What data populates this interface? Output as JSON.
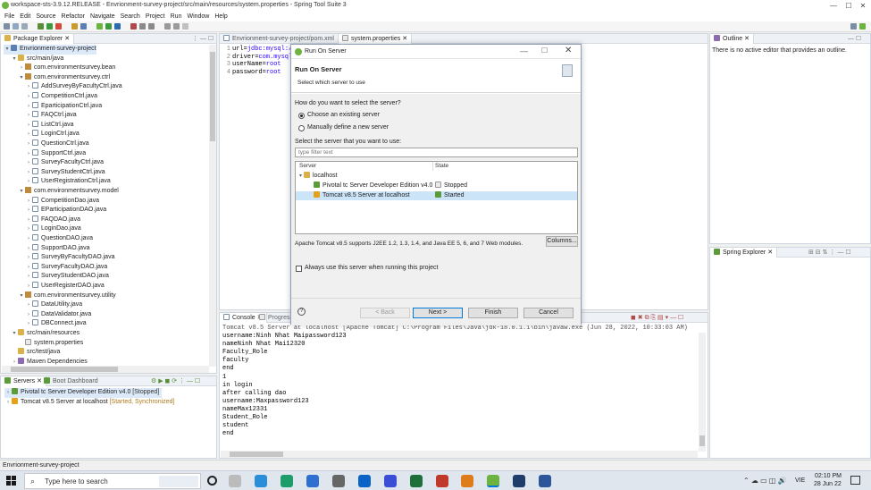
{
  "window": {
    "title": "workspace-sts-3.9.12.RELEASE - Envrionment-survey-project/src/main/resources/system.properties - Spring Tool Suite 3"
  },
  "menu": [
    "File",
    "Edit",
    "Source",
    "Refactor",
    "Navigate",
    "Search",
    "Project",
    "Run",
    "Window",
    "Help"
  ],
  "package_explorer": {
    "tab": "Package Explorer",
    "tree": [
      {
        "label": "Envrionment-survey-project",
        "level": 0,
        "icon": "proj",
        "exp": "▾"
      },
      {
        "label": "src/main/java",
        "level": 1,
        "icon": "folder",
        "exp": "▾"
      },
      {
        "label": "com.environmentsurvey.bean",
        "level": 2,
        "icon": "pkg",
        "exp": "›"
      },
      {
        "label": "com.environmentsurvey.ctrl",
        "level": 2,
        "icon": "pkg",
        "exp": "▾"
      },
      {
        "label": "AddSurveyByFacultyCtrl.java",
        "level": 3,
        "icon": "java",
        "exp": "›"
      },
      {
        "label": "CompetitionCtrl.java",
        "level": 3,
        "icon": "java",
        "exp": "›"
      },
      {
        "label": "EparticipationCtrl.java",
        "level": 3,
        "icon": "java",
        "exp": "›"
      },
      {
        "label": "FAQCtrl.java",
        "level": 3,
        "icon": "java",
        "exp": "›"
      },
      {
        "label": "ListCtrl.java",
        "level": 3,
        "icon": "java",
        "exp": "›"
      },
      {
        "label": "LoginCtrl.java",
        "level": 3,
        "icon": "java",
        "exp": "›"
      },
      {
        "label": "QuestionCtrl.java",
        "level": 3,
        "icon": "java",
        "exp": "›"
      },
      {
        "label": "SupportCtrl.java",
        "level": 3,
        "icon": "java",
        "exp": "›"
      },
      {
        "label": "SurveyFacultyCtrl.java",
        "level": 3,
        "icon": "java",
        "exp": "›"
      },
      {
        "label": "SurveyStudentCtrl.java",
        "level": 3,
        "icon": "java",
        "exp": "›"
      },
      {
        "label": "UserRegistrationCtrl.java",
        "level": 3,
        "icon": "java",
        "exp": "›"
      },
      {
        "label": "com.environmentsurvey.model",
        "level": 2,
        "icon": "pkg",
        "exp": "▾"
      },
      {
        "label": "CompetitionDao.java",
        "level": 3,
        "icon": "java",
        "exp": "›"
      },
      {
        "label": "EParticipationDAO.java",
        "level": 3,
        "icon": "java",
        "exp": "›"
      },
      {
        "label": "FAQDAO.java",
        "level": 3,
        "icon": "java",
        "exp": "›"
      },
      {
        "label": "LoginDao.java",
        "level": 3,
        "icon": "java",
        "exp": "›"
      },
      {
        "label": "QuestionDAO.java",
        "level": 3,
        "icon": "java",
        "exp": "›"
      },
      {
        "label": "SupportDAO.java",
        "level": 3,
        "icon": "java",
        "exp": "›"
      },
      {
        "label": "SurveyByFacultyDAO.java",
        "level": 3,
        "icon": "java",
        "exp": "›"
      },
      {
        "label": "SurveyFacultyDAO.java",
        "level": 3,
        "icon": "java",
        "exp": "›"
      },
      {
        "label": "SurveyStudentDAO.java",
        "level": 3,
        "icon": "java",
        "exp": "›"
      },
      {
        "label": "UserRegisterDAO.java",
        "level": 3,
        "icon": "java",
        "exp": "›"
      },
      {
        "label": "com.environmentsurvey.utility",
        "level": 2,
        "icon": "pkg",
        "exp": "▾"
      },
      {
        "label": "DataUtility.java",
        "level": 3,
        "icon": "java",
        "exp": "›"
      },
      {
        "label": "DataValidator.java",
        "level": 3,
        "icon": "java",
        "exp": "›"
      },
      {
        "label": "DBConnect.java",
        "level": 3,
        "icon": "java",
        "exp": "›"
      },
      {
        "label": "src/main/resources",
        "level": 1,
        "icon": "folder",
        "exp": "▾"
      },
      {
        "label": "system.properties",
        "level": 2,
        "icon": "prop",
        "exp": ""
      },
      {
        "label": "src/test/java",
        "level": 1,
        "icon": "folder",
        "exp": ""
      },
      {
        "label": "Maven Dependencies",
        "level": 1,
        "icon": "lib",
        "exp": "›"
      }
    ]
  },
  "servers": {
    "tab": "Servers",
    "tab2": "Boot Dashboard",
    "items": [
      {
        "name": "Pivotal tc Server Developer Edition v4.0",
        "status": "[Stopped]",
        "selected": true
      },
      {
        "name": "Tomcat v8.5 Server at localhost",
        "status": "[Started, Synchronized]",
        "selected": false
      }
    ]
  },
  "editor": {
    "tabs": [
      "Envrionment-survey-project/pom.xml",
      "system.properties"
    ],
    "lines": [
      {
        "n": "1",
        "key": "url=",
        "val": "jdbc:mysql:/"
      },
      {
        "n": "2",
        "key": "driver=",
        "val": "com.mysql"
      },
      {
        "n": "3",
        "key": "userName=",
        "val": "root"
      },
      {
        "n": "4",
        "key": "password=",
        "val": "root"
      }
    ]
  },
  "outline": {
    "tab": "Outline",
    "message": "There is no active editor that provides an outline."
  },
  "spring_explorer": {
    "tab": "Spring Explorer"
  },
  "console": {
    "tab": "Console",
    "tab2": "Progress",
    "header": "Tomcat v8.5 Server at localhost [Apache Tomcat] C:\\Program Files\\Java\\jdk-18.0.1.1\\bin\\javaw.exe (Jun 28, 2022, 10:33:03 AM)",
    "lines": [
      "username:Ninh Nhat Maipassword123",
      "nameNinh Nhat Mai12320",
      "Faculty_Role",
      "faculty",
      "end",
      "1",
      "in login",
      "after calling dao",
      "username:Maxpassword123",
      "nameMax12331",
      "Student_Role",
      "student",
      "end"
    ]
  },
  "dialog": {
    "title": "Run On Server",
    "heading": "Run On Server",
    "subheading": "Select which server to use",
    "question": "How do you want to select the server?",
    "option_existing": "Choose an existing server",
    "option_new": "Manually define a new server",
    "select_label": "Select the server that you want to use:",
    "filter_placeholder": "type filter text",
    "col_server": "Server",
    "col_state": "State",
    "host": "localhost",
    "servers": [
      {
        "name": "Pivotal tc Server Developer Edition v4.0",
        "state": "Stopped",
        "selected": false
      },
      {
        "name": "Tomcat v8.5 Server at localhost",
        "state": "Started",
        "selected": true
      }
    ],
    "description": "Apache Tomcat v8.5 supports J2EE 1.2, 1.3, 1.4, and Java EE 5, 6, and 7 Web modules.",
    "columns_button": "Columns...",
    "always_use": "Always use this server when running this project",
    "back": "< Back",
    "next": "Next >",
    "finish": "Finish",
    "cancel": "Cancel",
    "help": "?"
  },
  "status_bar": {
    "text": "Envrionment-survey-project"
  },
  "taskbar": {
    "search_placeholder": "Type here to search",
    "time": "02:10 PM",
    "date": "28 Jun 22",
    "lang": "VIE"
  }
}
